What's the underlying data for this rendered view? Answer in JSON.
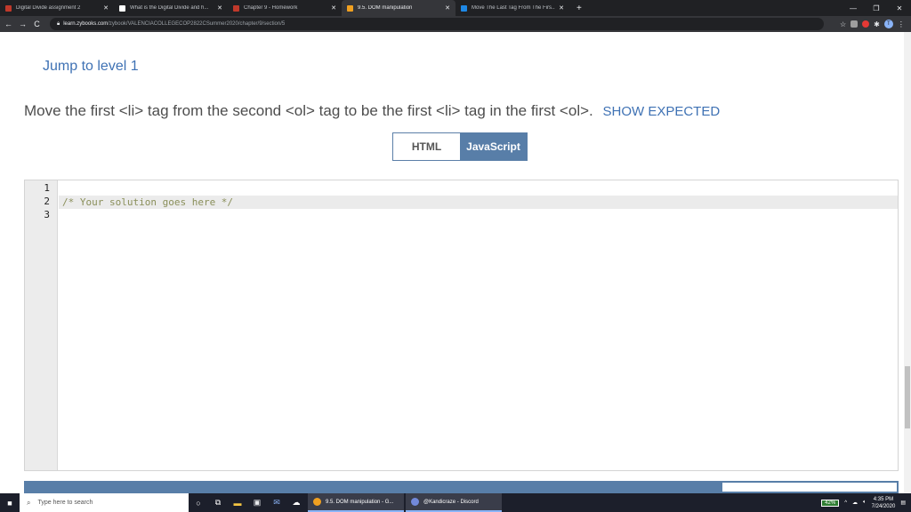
{
  "browser": {
    "tabs": [
      {
        "label": "Digital Divide assignment 2",
        "favicon_color": "#c0392b",
        "active": false
      },
      {
        "label": "What is the Digital Divide and h...",
        "favicon_color": "#ffffff",
        "active": false
      },
      {
        "label": "Chapter 9 - Homework",
        "favicon_color": "#c0392b",
        "active": false
      },
      {
        "label": "9.5. DOM manipulation",
        "favicon_color": "#f0a020",
        "active": true
      },
      {
        "label": "Move The Last Tag From The Firs...",
        "favicon_color": "#1e88e5",
        "active": false
      }
    ],
    "new_tab": "+",
    "window_controls": [
      "—",
      "❐",
      "✕"
    ],
    "nav": {
      "back": "←",
      "forward": "→",
      "reload": "C"
    },
    "url_host": "learn.zybooks.com",
    "url_path": "/zybook/VALENCIACOLLEGECOP2822CSummer2020/chapter/9/section/5",
    "profile_letter": "T"
  },
  "page": {
    "jump_link": "Jump to level 1",
    "instruction": "Move the first <li> tag from the second <ol> tag to be the first <li> tag in the first <ol>.",
    "show_expected": "SHOW EXPECTED",
    "lang_tabs": [
      "HTML",
      "JavaScript"
    ],
    "active_lang": "JavaScript",
    "editor": {
      "line_numbers": [
        "1",
        "2",
        "3"
      ],
      "code_line_2": "/* Your solution goes here */"
    }
  },
  "taskbar": {
    "search_placeholder": "Type here to search",
    "windows": [
      {
        "label": "9.5. DOM manipulation - G...",
        "color": "#f0a020"
      },
      {
        "label": "@Kandicraze - Discord",
        "color": "#7289da"
      }
    ],
    "battery": "42%",
    "time": "4:35 PM",
    "date": "7/24/2020"
  }
}
